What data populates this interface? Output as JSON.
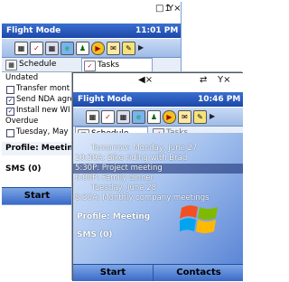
{
  "back": {
    "status_icons": [
      "signal-off-icon",
      "no-signal-icon"
    ],
    "title": "Flight Mode",
    "time": "11:01 PM",
    "tabs": [
      {
        "label": "Schedule",
        "icon": "calendar-icon"
      },
      {
        "label": "Tasks",
        "icon": "tasks-icon"
      }
    ],
    "tasks": [
      {
        "kind": "group",
        "text": "Undated"
      },
      {
        "kind": "task",
        "text": "Transfer mont",
        "checked": false
      },
      {
        "kind": "task",
        "text": "Send NDA agre",
        "checked": true
      },
      {
        "kind": "task",
        "text": "Install new WI",
        "checked": true
      },
      {
        "kind": "group",
        "text": "Overdue"
      },
      {
        "kind": "task",
        "text": "Tuesday, May",
        "checked": false
      }
    ],
    "profile": "Profile: Meeting",
    "sms": "SMS (0)",
    "softkeys": [
      "Start"
    ]
  },
  "front": {
    "status_icons": [
      "speaker-mute-icon",
      "sync-icon",
      "no-signal-icon"
    ],
    "title": "Flight Mode",
    "time": "10:46 PM",
    "tabs": [
      {
        "label": "Schedule",
        "icon": "calendar-icon"
      },
      {
        "label": "Tasks",
        "icon": "tasks-icon"
      }
    ],
    "appointments": [
      {
        "text": "Tomorrow: Monday, June 27",
        "kind": "header"
      },
      {
        "text": "10:30A: Bike riding with Brad",
        "kind": "item"
      },
      {
        "text": "5:30P: Project meeting",
        "kind": "item",
        "selected": true
      },
      {
        "text": "6:00P: Family dinner",
        "kind": "item"
      },
      {
        "text": "Tuesday, June 28",
        "kind": "header"
      },
      {
        "text": "8:30A: Monthly company meetings",
        "kind": "item"
      }
    ],
    "profile": "Profile: Meeting",
    "sms": "SMS (0)",
    "softkeys": [
      "Start",
      "Contacts"
    ]
  },
  "quick_launch_icons": [
    "calendar-icon",
    "tasks-icon",
    "calculator-icon",
    "internet-explorer-icon",
    "contacts-icon",
    "media-player-icon",
    "messaging-icon",
    "notes-icon"
  ],
  "colors": {
    "title_bar": "#2454b8",
    "soft_bar": "#5a88d8",
    "highlight": "#d4e0f4"
  }
}
